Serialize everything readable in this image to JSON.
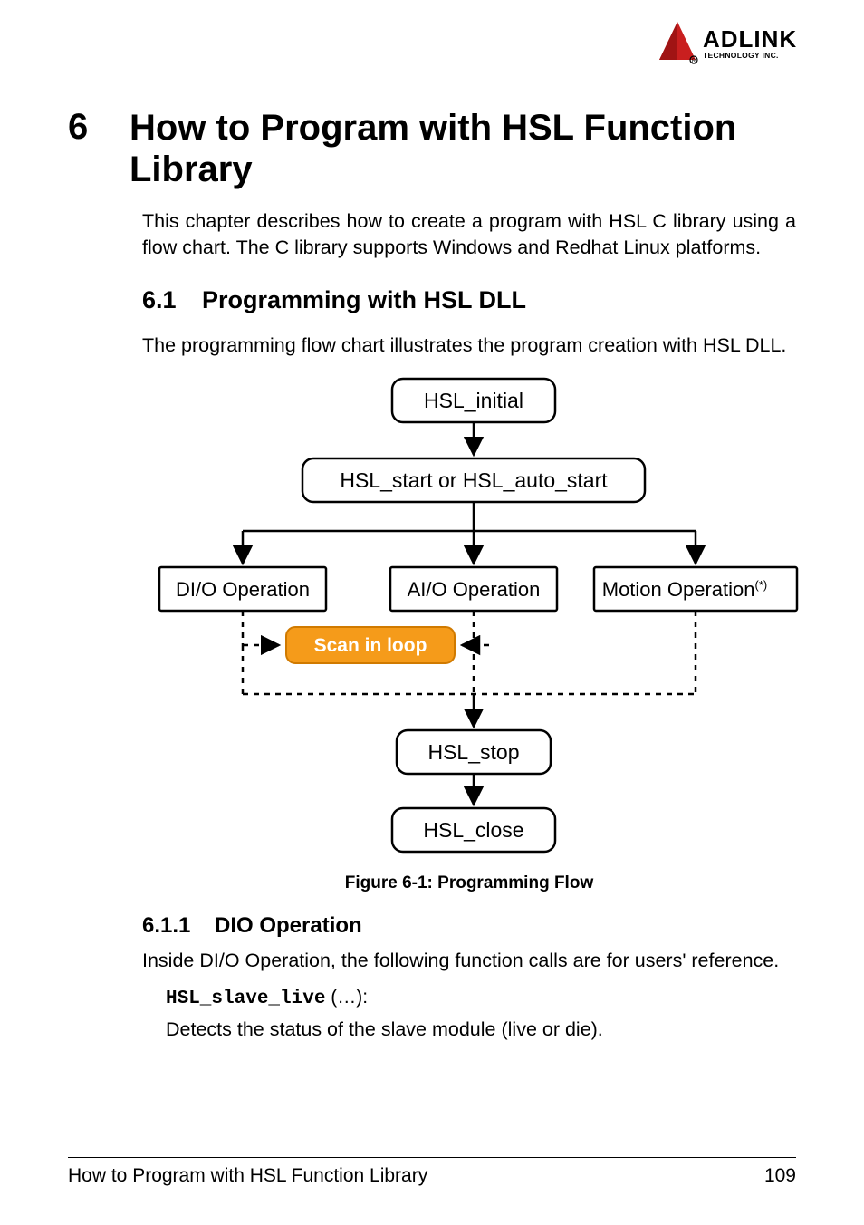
{
  "logo": {
    "brand_top": "ADLINK",
    "brand_sub": "TECHNOLOGY INC."
  },
  "chapter": {
    "number": "6",
    "title": "How to Program with HSL Function Library",
    "intro": "This chapter describes how to create a program with HSL C library using a flow chart. The C library supports Windows and Redhat Linux platforms."
  },
  "section": {
    "number": "6.1",
    "title": "Programming with HSL DLL",
    "intro": "The programming flow chart illustrates the program creation with HSL DLL."
  },
  "flowchart": {
    "box_initial": "HSL_initial",
    "box_start": "HSL_start or HSL_auto_start",
    "box_dio": "DI/O Operation",
    "box_aio": "AI/O Operation",
    "box_motion": "Motion Operation",
    "motion_star": "(*)",
    "scan_loop": "Scan in loop",
    "box_stop": "HSL_stop",
    "box_close": "HSL_close"
  },
  "figure_caption": "Figure 6-1: Programming Flow",
  "subsection": {
    "number": "6.1.1",
    "title": "DIO Operation",
    "intro": "Inside DI/O Operation, the following function calls are for users' reference."
  },
  "code": {
    "func": "HSL_slave_live",
    "suffix": " (…):",
    "desc": "Detects the status of the slave module (live or die)."
  },
  "footer": {
    "left": "How to Program with HSL Function Library",
    "right": "109"
  }
}
